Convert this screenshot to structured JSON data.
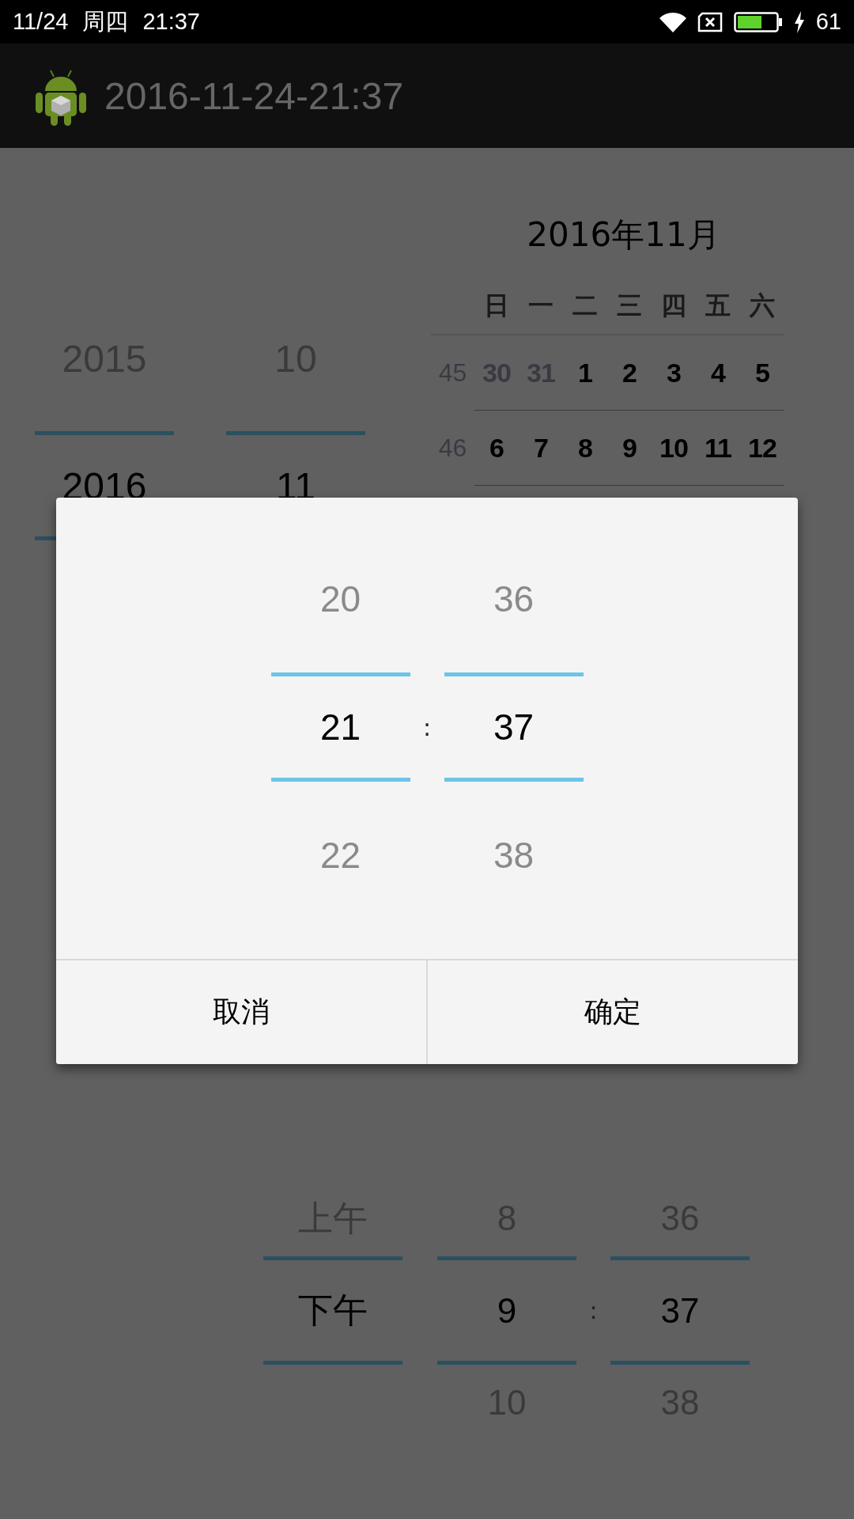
{
  "status_bar": {
    "date": "11/24",
    "weekday": "周四",
    "time": "21:37",
    "battery": "61"
  },
  "app_bar": {
    "title": "2016-11-24-21:37"
  },
  "date_picker": {
    "columns": [
      {
        "kind": "wheel",
        "items": [
          {
            "label": "2015",
            "selected": false
          },
          {
            "label": "2016",
            "selected": true
          }
        ]
      },
      {
        "kind": "wheel",
        "items": [
          {
            "label": "10",
            "selected": false
          },
          {
            "label": "11",
            "selected": true
          }
        ]
      }
    ]
  },
  "calendar": {
    "title": "2016年11月",
    "weekdays": [
      "日",
      "一",
      "二",
      "三",
      "四",
      "五",
      "六"
    ],
    "weeks": [
      {
        "number": "45",
        "days": [
          {
            "label": "30",
            "outside_month": true
          },
          {
            "label": "31",
            "outside_month": true
          },
          {
            "label": "1",
            "outside_month": false
          },
          {
            "label": "2",
            "outside_month": false
          },
          {
            "label": "3",
            "outside_month": false
          },
          {
            "label": "4",
            "outside_month": false
          },
          {
            "label": "5",
            "outside_month": false
          }
        ]
      },
      {
        "number": "46",
        "days": [
          {
            "label": "6",
            "outside_month": false
          },
          {
            "label": "7",
            "outside_month": false
          },
          {
            "label": "8",
            "outside_month": false
          },
          {
            "label": "9",
            "outside_month": false
          },
          {
            "label": "10",
            "outside_month": false
          },
          {
            "label": "11",
            "outside_month": false
          },
          {
            "label": "12",
            "outside_month": false
          }
        ]
      }
    ]
  },
  "time_picker": {
    "columns": [
      {
        "kind": "wheel",
        "items": [
          {
            "label": "上午",
            "selected": false
          },
          {
            "label": "下午",
            "selected": true
          }
        ]
      },
      {
        "kind": "wheel",
        "items": [
          {
            "label": "8",
            "selected": false
          },
          {
            "label": "9",
            "selected": true
          },
          {
            "label": "10",
            "selected": false
          }
        ]
      },
      {
        "kind": "separator",
        "label": ":"
      },
      {
        "kind": "wheel",
        "items": [
          {
            "label": "36",
            "selected": false
          },
          {
            "label": "37",
            "selected": true
          },
          {
            "label": "38",
            "selected": false
          }
        ]
      }
    ]
  },
  "dialog": {
    "columns": [
      {
        "kind": "wheel",
        "items": [
          {
            "label": "20",
            "selected": false
          },
          {
            "label": "21",
            "selected": true
          },
          {
            "label": "22",
            "selected": false
          }
        ]
      },
      {
        "kind": "separator",
        "label": ":"
      },
      {
        "kind": "wheel",
        "items": [
          {
            "label": "36",
            "selected": false
          },
          {
            "label": "37",
            "selected": true
          },
          {
            "label": "38",
            "selected": false
          }
        ]
      }
    ],
    "buttons": [
      "取消",
      "确定"
    ]
  }
}
